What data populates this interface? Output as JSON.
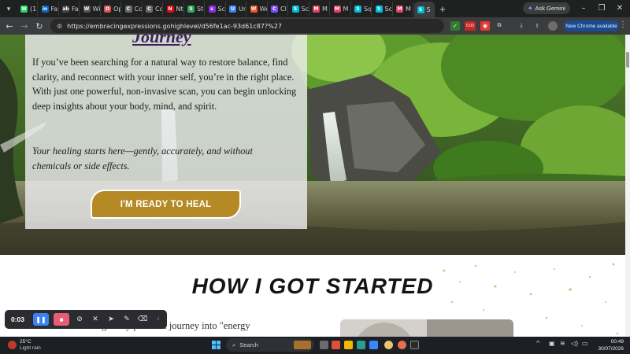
{
  "browser": {
    "tabs": [
      {
        "label": "(1)",
        "color": "#25d366",
        "glyph": "W"
      },
      {
        "label": "Fa",
        "color": "#0a66c2",
        "glyph": "in"
      },
      {
        "label": "Fa",
        "color": "#444444",
        "glyph": "ab"
      },
      {
        "label": "Wi",
        "color": "#555555",
        "glyph": "W"
      },
      {
        "label": "Op",
        "color": "#d9534f",
        "glyph": "O"
      },
      {
        "label": "Cc",
        "color": "#6a6a6a",
        "glyph": "C"
      },
      {
        "label": "Cc",
        "color": "#6a6a6a",
        "glyph": "C"
      },
      {
        "label": "Nt",
        "color": "#e50914",
        "glyph": "N"
      },
      {
        "label": "St",
        "color": "#3aa55d",
        "glyph": "S"
      },
      {
        "label": "Sc",
        "color": "#8a2be2",
        "glyph": "s"
      },
      {
        "label": "Ur",
        "color": "#3b82f6",
        "glyph": "U"
      },
      {
        "label": "We",
        "color": "#f4511e",
        "glyph": "W"
      },
      {
        "label": "Cl",
        "color": "#7c4dff",
        "glyph": "C"
      },
      {
        "label": "Sc",
        "color": "#00bcd4",
        "glyph": "S"
      },
      {
        "label": "M",
        "color": "#e4405f",
        "glyph": "M"
      },
      {
        "label": "M",
        "color": "#e4405f",
        "glyph": "M"
      },
      {
        "label": "Sq",
        "color": "#00bcd4",
        "glyph": "S"
      },
      {
        "label": "Sc",
        "color": "#00bcd4",
        "glyph": "S"
      },
      {
        "label": "M",
        "color": "#e4405f",
        "glyph": "M"
      },
      {
        "label": "S",
        "color": "#00bcd4",
        "glyph": "S",
        "active": true
      }
    ],
    "new_tab": "+",
    "ask_gemini": "Ask Gemini",
    "url": "https://embracingexpressions.gohighlevel/d56fe1ac-93d61c87?%27",
    "extension_badge": "0.03",
    "chrome_available": "New Chrome available"
  },
  "page": {
    "hero_heading": "Journey",
    "hero_paragraph": "If you’ve been searching for a natural way to restore balance, find clarity, and reconnect with your inner self, you’re in the right place. With just one powerful, non-invasive scan, you can begin unlocking deep insights about your body, mind, and spirit.",
    "hero_tagline": "Your healing starts here—gently, accurately, and without chemicals or side effects.",
    "cta_label": "I'M READY TO HEAL",
    "section_title": "HOW I GOT STARTED",
    "section_text": "I began my personal journey into \"energy"
  },
  "recorder": {
    "time": "0:03",
    "accent_pause": "#3b82f6",
    "accent_stop": "#e85d75"
  },
  "taskbar": {
    "weather_temp": "25°C",
    "weather_condition": "Light rain",
    "search_placeholder": "Search",
    "time": "00:49",
    "date": "30/07/2026"
  },
  "colors": {
    "cta": "#b58a25",
    "heading": "#3e1f5c",
    "tab_strip": "#1f2020",
    "toolbar": "#3b3c3d"
  }
}
